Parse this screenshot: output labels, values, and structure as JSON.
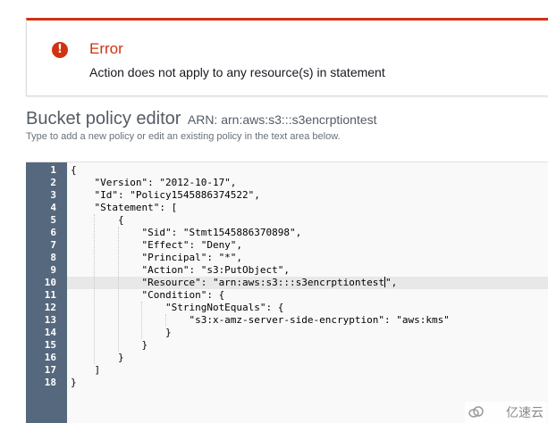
{
  "error": {
    "title": "Error",
    "message": "Action does not apply to any resource(s) in statement",
    "icon": "exclamation-circle-icon",
    "icon_glyph": "!",
    "color": "#d13212"
  },
  "editor": {
    "title": "Bucket policy editor",
    "arn": "ARN: arn:aws:s3:::s3encrptiontest",
    "hint": "Type to add a new policy or edit an existing policy in the text area below.",
    "active_line": 10,
    "line_numbers": [
      "1",
      "2",
      "3",
      "4",
      "5",
      "6",
      "7",
      "8",
      "9",
      "10",
      "11",
      "12",
      "13",
      "14",
      "15",
      "16",
      "17",
      "18"
    ],
    "lines": [
      "{",
      "    \"Version\": \"2012-10-17\",",
      "    \"Id\": \"Policy1545886374522\",",
      "    \"Statement\": [",
      "        {",
      "            \"Sid\": \"Stmt1545886370898\",",
      "            \"Effect\": \"Deny\",",
      "            \"Principal\": \"*\",",
      "            \"Action\": \"s3:PutObject\",",
      "            \"Resource\": \"arn:aws:s3:::s3encrptiontest",
      "            \"Condition\": {",
      "                \"StringNotEquals\": {",
      "                    \"s3:x-amz-server-side-encryption\": \"aws:kms\"",
      "                }",
      "            }",
      "        }",
      "    ]",
      "}"
    ],
    "active_line_suffix": "\","
  },
  "watermark": {
    "text": "亿速云",
    "icon": "cloud-logo-icon"
  }
}
